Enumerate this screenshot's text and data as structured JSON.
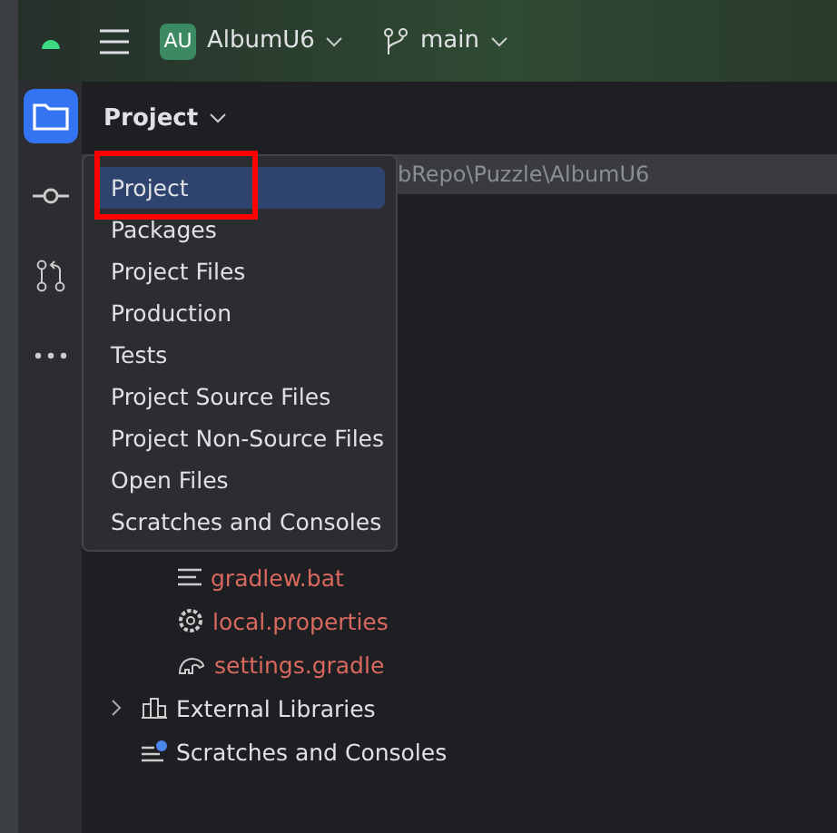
{
  "toolbar": {
    "project_badge": "AU",
    "project_name": "AlbumU6",
    "branch": "main"
  },
  "tool_strip": [
    {
      "kind": "folder",
      "selected": true
    },
    {
      "kind": "commit",
      "selected": false
    },
    {
      "kind": "pull",
      "selected": false
    },
    {
      "kind": "more",
      "selected": false
    }
  ],
  "panel": {
    "title": "Project",
    "path": "bRepo\\Puzzle\\AlbumU6"
  },
  "view_menu": [
    {
      "label": "Project",
      "selected": true,
      "marked": true
    },
    {
      "label": "Packages",
      "selected": false,
      "marked": false
    },
    {
      "label": "Project Files",
      "selected": false,
      "marked": false
    },
    {
      "label": "Production",
      "selected": false,
      "marked": false
    },
    {
      "label": "Tests",
      "selected": false,
      "marked": false
    },
    {
      "label": "Project Source Files",
      "selected": false,
      "marked": false
    },
    {
      "label": "Project Non-Source Files",
      "selected": false,
      "marked": false
    },
    {
      "label": "Open Files",
      "selected": false,
      "marked": false
    },
    {
      "label": "Scratches and Consoles",
      "selected": false,
      "marked": false
    }
  ],
  "tree": {
    "nested_files": [
      {
        "label": "gradlew.bat",
        "kind": "text",
        "color": "#d9695f"
      },
      {
        "label": "local.properties",
        "kind": "gear",
        "color": "#d9695f"
      },
      {
        "label": "settings.gradle",
        "kind": "gradle",
        "color": "#d9695f"
      }
    ],
    "roots": [
      {
        "label": "External Libraries",
        "kind": "library",
        "expanded": false
      },
      {
        "label": "Scratches and Consoles",
        "kind": "scratch"
      }
    ]
  }
}
